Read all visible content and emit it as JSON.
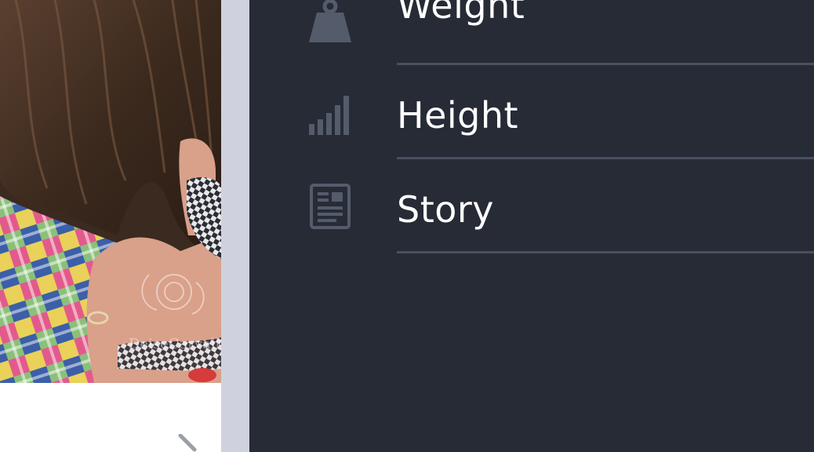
{
  "card": {
    "watermark_text": "DeiseCarvalho"
  },
  "menu": {
    "items": [
      {
        "label": "Weight",
        "icon": "weight-icon"
      },
      {
        "label": "Height",
        "icon": "height-bars-icon"
      },
      {
        "label": "Story",
        "icon": "story-document-icon"
      }
    ]
  },
  "colors": {
    "drawer_bg": "#262b36",
    "divider": "#4a5060",
    "icon": "#545b6b",
    "text": "#ffffff",
    "strip": "#cfd2de"
  }
}
